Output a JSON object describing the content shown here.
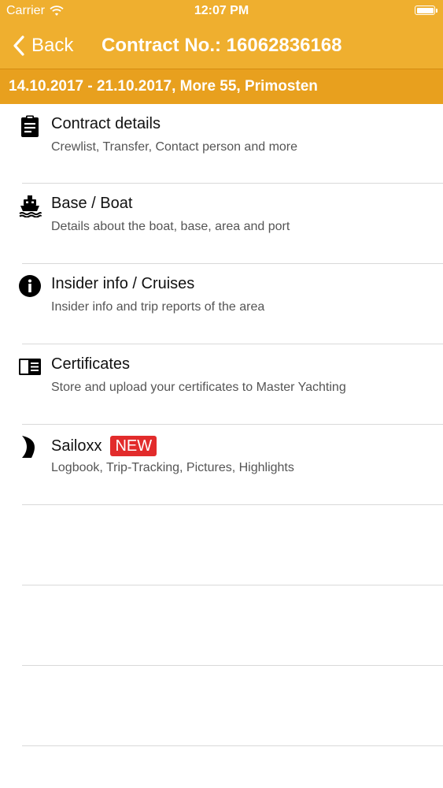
{
  "status_bar": {
    "carrier": "Carrier",
    "time": "12:07 PM"
  },
  "nav": {
    "back_label": "Back",
    "title": "Contract No.: 16062836168"
  },
  "subheader": "14.10.2017 - 21.10.2017, More 55, Primosten",
  "menu": [
    {
      "icon": "clipboard-icon",
      "title": "Contract details",
      "subtitle": "Crewlist, Transfer, Contact person and more"
    },
    {
      "icon": "ship-icon",
      "title": "Base / Boat",
      "subtitle": "Details about the boat, base, area and port"
    },
    {
      "icon": "info-icon",
      "title": "Insider info / Cruises",
      "subtitle": "Insider info and trip reports of the area"
    },
    {
      "icon": "certificate-icon",
      "title": "Certificates",
      "subtitle": "Store and upload your certificates to Master Yachting"
    },
    {
      "icon": "sailoxx-logo-icon",
      "title": "Sailoxx",
      "badge": "NEW",
      "subtitle": "Logbook, Trip-Tracking, Pictures, Highlights"
    }
  ],
  "colors": {
    "nav_background": "#efaf2f",
    "subheader_background": "#e8a01e",
    "badge_background": "#e22b2b",
    "separator": "#d9d9d9"
  }
}
